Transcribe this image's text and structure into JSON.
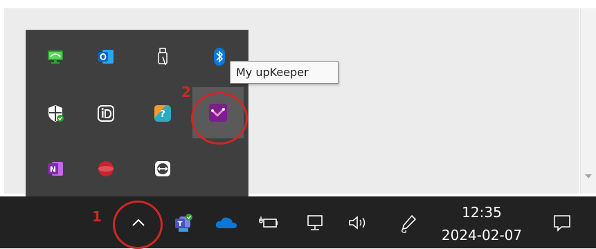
{
  "tooltip": {
    "text": "My upKeeper"
  },
  "overflow_tray": {
    "icons": [
      {
        "name": "remote-desktop-icon",
        "color": "#3aa83a"
      },
      {
        "name": "outlook-icon",
        "color": "#0a64c8"
      },
      {
        "name": "usb-device-icon",
        "color": "#ffffff"
      },
      {
        "name": "bluetooth-icon",
        "color": "#0a78d7"
      },
      {
        "name": "windows-security-icon",
        "color": "#ffffff"
      },
      {
        "name": "identity-app-icon",
        "color": "#ffffff"
      },
      {
        "name": "support-app-icon",
        "color": "#f29a2e"
      },
      {
        "name": "upkeeper-icon",
        "color": "#7a1f8c"
      },
      {
        "name": "onenote-icon",
        "color": "#7b2ea8"
      },
      {
        "name": "red-circle-app-icon",
        "color": "#c8232e"
      },
      {
        "name": "teamviewer-icon",
        "color": "#ffffff"
      }
    ]
  },
  "taskbar": {
    "icons": [
      "show-hidden-icons-chevron-icon",
      "teams-new-icon",
      "onedrive-icon",
      "battery-power-icon",
      "network-icon",
      "volume-icon",
      "pen-icon",
      "notifications-icon"
    ]
  },
  "clock": {
    "time": "12:35",
    "date": "2024-02-07"
  },
  "annotations": {
    "marker1": "1",
    "marker2": "2",
    "color": "#d12626"
  }
}
